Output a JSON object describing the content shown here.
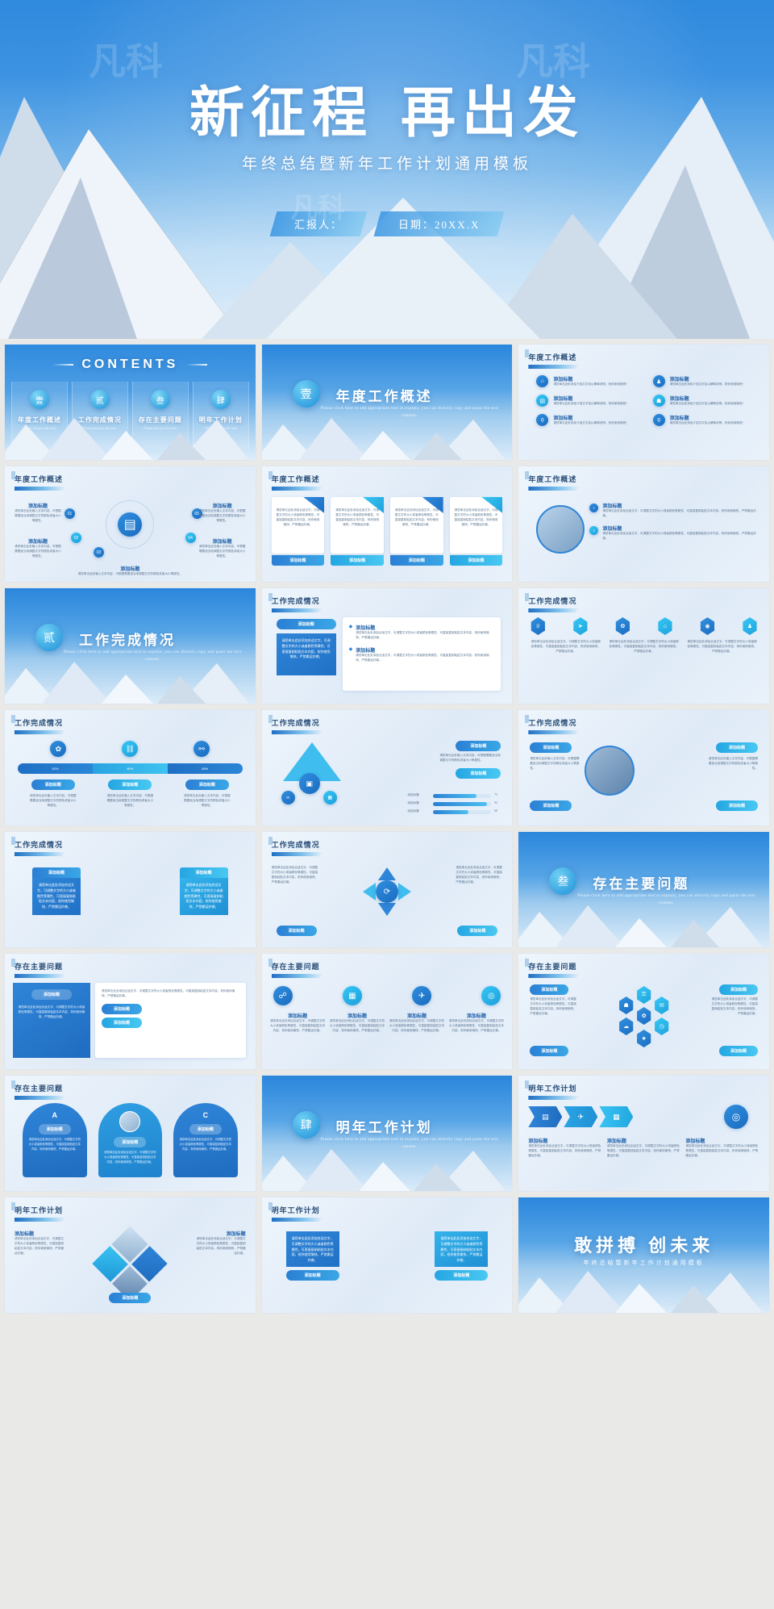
{
  "cover": {
    "title_left": "新征程",
    "title_right": "再出发",
    "subtitle": "年终总结暨新年工作计划通用模板",
    "presenter_label": "汇报人：",
    "date_label": "日期：20XX.X",
    "watermark": "凡科"
  },
  "palette": {
    "brand_blue": "#1f6fc4",
    "accent_cyan": "#34c6f4",
    "deep_blue": "#1b6cc0",
    "title_text": "#2a4f79",
    "body_text": "#5b7590"
  },
  "contents": {
    "heading": "CONTENTS",
    "items": [
      {
        "badge": "壹",
        "name": "年度工作概述",
        "en": "Please add your title here"
      },
      {
        "badge": "贰",
        "name": "工作完成情况",
        "en": "Please add your title here"
      },
      {
        "badge": "叁",
        "name": "存在主要问题",
        "en": "Please add your title here"
      },
      {
        "badge": "肆",
        "name": "明年工作计划",
        "en": "Please add your title here"
      }
    ]
  },
  "sections": [
    {
      "badge": "壹",
      "title": "年度工作概述",
      "desc": "Please click here to add appropriate text to explain, you can directly copy and paste the text content."
    },
    {
      "badge": "贰",
      "title": "工作完成情况",
      "desc": "Please click here to add appropriate text to explain, you can directly copy and paste the text content."
    },
    {
      "badge": "叁",
      "title": "存在主要问题",
      "desc": "Please click here to add appropriate text to explain, you can directly copy and paste the text content."
    },
    {
      "badge": "肆",
      "title": "明年工作计划",
      "desc": "Please click here to add appropriate text to explain, you can directly copy and paste the text content."
    }
  ],
  "labels": {
    "add_title": "添加标题",
    "body_short": "请您单击此处添加介绍文字加以解释，祝你使用愉快！",
    "body_medium": "请您单击此处输入文本内容，可根据需要适当地调整文字的颜色或者大小等属性。",
    "body_long": "请您单击此处添加合适文字，可调整文字的大小或者颜色等属性，可直接复制粘贴文本内容，祝你使用愉快，严禁搬运抄袭。",
    "click_here": "单击此处"
  },
  "overview_icons": [
    {
      "icon": "home-icon",
      "title": "添加标题",
      "body": "请您单击此处添加介绍文字加以解释说明，祝你使用愉快！"
    },
    {
      "icon": "cup-icon",
      "title": "添加标题",
      "body": "请您单击此处添加介绍文字加以解释说明，祝你使用愉快！"
    },
    {
      "icon": "document-icon",
      "title": "添加标题",
      "body": "请您单击此处添加介绍文字加以解释说明，祝你使用愉快！"
    },
    {
      "icon": "user-icon",
      "title": "添加标题",
      "body": "请您单击此处添加介绍文字加以解释说明，祝你使用愉快！"
    },
    {
      "icon": "bulb-icon",
      "title": "添加标题",
      "body": "请您单击此处添加介绍文字加以解释说明，祝你使用愉快！"
    },
    {
      "icon": "medal-icon",
      "title": "添加标题",
      "body": "请您单击此处添加介绍文字加以解释说明，祝你使用愉快！"
    }
  ],
  "orbit_steps": [
    "01",
    "02",
    "03",
    "04",
    "05"
  ],
  "chart_data": {
    "type": "bar",
    "title": "工作完成情况",
    "segments": {
      "type": "bar",
      "categories": [
        "添加标题",
        "添加标题",
        "添加标题"
      ],
      "values": [
        92,
        80,
        89
      ],
      "unit": "%",
      "labels": [
        "92%",
        "80%",
        "89%"
      ]
    },
    "progress": {
      "type": "bar",
      "categories": [
        "添加标题",
        "添加标题",
        "添加标题"
      ],
      "values": [
        75,
        92,
        60
      ],
      "unit": "%",
      "labels": [
        "75",
        "92",
        "60"
      ],
      "xlabel": "",
      "ylabel": "",
      "xlim": [
        0,
        100
      ]
    }
  },
  "closing": {
    "title": "敢拼搏 创未来",
    "subtitle": "年终总结暨新年工作计划通用模板"
  },
  "slides": [
    {
      "id": 1,
      "kind": "contents",
      "title": "CONTENTS"
    },
    {
      "id": 2,
      "kind": "section",
      "title": "年度工作概述",
      "badge": "壹"
    },
    {
      "id": 3,
      "kind": "icon-grid-6",
      "title": "年度工作概述"
    },
    {
      "id": 4,
      "kind": "orbit",
      "title": "年度工作概述"
    },
    {
      "id": 5,
      "kind": "cards-4",
      "title": "年度工作概述"
    },
    {
      "id": 6,
      "kind": "photo-list",
      "title": "年度工作概述"
    },
    {
      "id": 7,
      "kind": "section",
      "title": "工作完成情况",
      "badge": "贰"
    },
    {
      "id": 8,
      "kind": "two-panel",
      "title": "工作完成情况"
    },
    {
      "id": 9,
      "kind": "hex-row",
      "title": "工作完成情况"
    },
    {
      "id": 10,
      "kind": "segments",
      "title": "工作完成情况"
    },
    {
      "id": 11,
      "kind": "triangle",
      "title": "工作完成情况"
    },
    {
      "id": 12,
      "kind": "photo-round",
      "title": "工作完成情况"
    },
    {
      "id": 13,
      "kind": "blocks-2",
      "title": "工作完成情况"
    },
    {
      "id": 14,
      "kind": "arrows-4",
      "title": "工作完成情况"
    },
    {
      "id": 15,
      "kind": "section",
      "title": "存在主要问题",
      "badge": "叁"
    },
    {
      "id": 16,
      "kind": "split-list",
      "title": "存在主要问题"
    },
    {
      "id": 17,
      "kind": "icon-row-4",
      "title": "存在主要问题"
    },
    {
      "id": 18,
      "kind": "hex-cluster",
      "title": "存在主要问题"
    },
    {
      "id": 19,
      "kind": "arches-3",
      "title": "存在主要问题"
    },
    {
      "id": 20,
      "kind": "section",
      "title": "明年工作计划",
      "badge": "肆"
    },
    {
      "id": 21,
      "kind": "chevrons",
      "title": "明年工作计划"
    },
    {
      "id": 22,
      "kind": "diamonds",
      "title": "明年工作计划"
    },
    {
      "id": 23,
      "kind": "boxes-2",
      "title": "明年工作计划"
    },
    {
      "id": 24,
      "kind": "closing",
      "title": "敢拼搏 创未来"
    }
  ]
}
